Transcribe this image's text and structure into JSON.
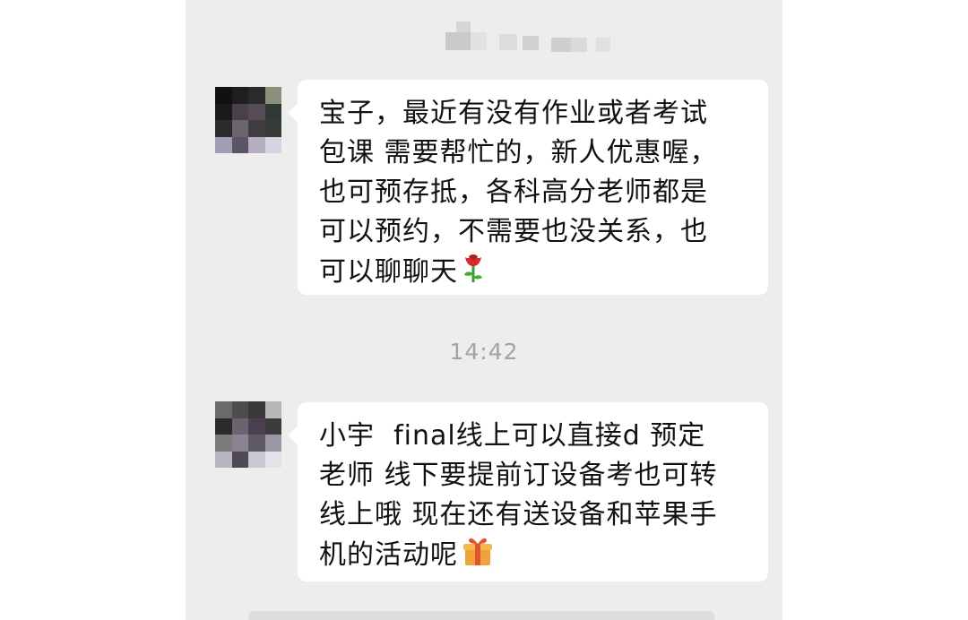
{
  "chat": {
    "header_name_blurred": "",
    "messages": [
      {
        "sender": "contact",
        "lines": [
          "宝子，最近有没有作业或者考试",
          "包课 需要帮忙的，新人优惠喔，",
          "也可预存抵，各科高分老师都是",
          "可以预约，不需要也没关系，也",
          "可以聊聊天"
        ],
        "trailing_emoji": "rose-icon"
      },
      {
        "sender": "contact",
        "lines": [
          "小宇  final线上可以直接d 预定",
          "老师 线下要提前订设备考也可转",
          "线上哦 现在还有送设备和苹果手",
          "机的活动呢"
        ],
        "trailing_emoji": "gift-icon"
      }
    ],
    "timestamp": "14:42"
  },
  "colors": {
    "chat_background": "#ededed",
    "bubble_background": "#ffffff",
    "timestamp_color": "#a3a3a3",
    "text_color": "#111111"
  }
}
